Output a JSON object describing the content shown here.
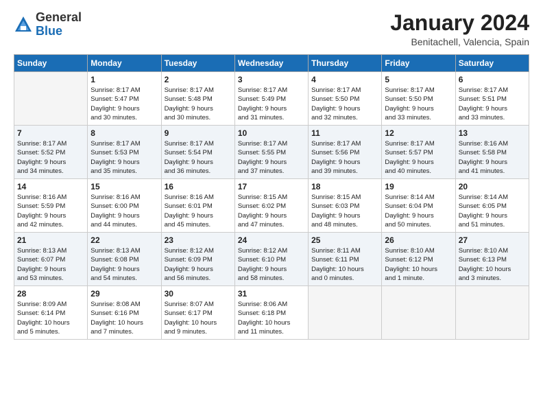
{
  "header": {
    "logo_general": "General",
    "logo_blue": "Blue",
    "month_title": "January 2024",
    "location": "Benitachell, Valencia, Spain"
  },
  "weekdays": [
    "Sunday",
    "Monday",
    "Tuesday",
    "Wednesday",
    "Thursday",
    "Friday",
    "Saturday"
  ],
  "weeks": [
    [
      {
        "day": "",
        "info": ""
      },
      {
        "day": "1",
        "info": "Sunrise: 8:17 AM\nSunset: 5:47 PM\nDaylight: 9 hours\nand 30 minutes."
      },
      {
        "day": "2",
        "info": "Sunrise: 8:17 AM\nSunset: 5:48 PM\nDaylight: 9 hours\nand 30 minutes."
      },
      {
        "day": "3",
        "info": "Sunrise: 8:17 AM\nSunset: 5:49 PM\nDaylight: 9 hours\nand 31 minutes."
      },
      {
        "day": "4",
        "info": "Sunrise: 8:17 AM\nSunset: 5:50 PM\nDaylight: 9 hours\nand 32 minutes."
      },
      {
        "day": "5",
        "info": "Sunrise: 8:17 AM\nSunset: 5:50 PM\nDaylight: 9 hours\nand 33 minutes."
      },
      {
        "day": "6",
        "info": "Sunrise: 8:17 AM\nSunset: 5:51 PM\nDaylight: 9 hours\nand 33 minutes."
      }
    ],
    [
      {
        "day": "7",
        "info": "Sunrise: 8:17 AM\nSunset: 5:52 PM\nDaylight: 9 hours\nand 34 minutes."
      },
      {
        "day": "8",
        "info": "Sunrise: 8:17 AM\nSunset: 5:53 PM\nDaylight: 9 hours\nand 35 minutes."
      },
      {
        "day": "9",
        "info": "Sunrise: 8:17 AM\nSunset: 5:54 PM\nDaylight: 9 hours\nand 36 minutes."
      },
      {
        "day": "10",
        "info": "Sunrise: 8:17 AM\nSunset: 5:55 PM\nDaylight: 9 hours\nand 37 minutes."
      },
      {
        "day": "11",
        "info": "Sunrise: 8:17 AM\nSunset: 5:56 PM\nDaylight: 9 hours\nand 39 minutes."
      },
      {
        "day": "12",
        "info": "Sunrise: 8:17 AM\nSunset: 5:57 PM\nDaylight: 9 hours\nand 40 minutes."
      },
      {
        "day": "13",
        "info": "Sunrise: 8:16 AM\nSunset: 5:58 PM\nDaylight: 9 hours\nand 41 minutes."
      }
    ],
    [
      {
        "day": "14",
        "info": "Sunrise: 8:16 AM\nSunset: 5:59 PM\nDaylight: 9 hours\nand 42 minutes."
      },
      {
        "day": "15",
        "info": "Sunrise: 8:16 AM\nSunset: 6:00 PM\nDaylight: 9 hours\nand 44 minutes."
      },
      {
        "day": "16",
        "info": "Sunrise: 8:16 AM\nSunset: 6:01 PM\nDaylight: 9 hours\nand 45 minutes."
      },
      {
        "day": "17",
        "info": "Sunrise: 8:15 AM\nSunset: 6:02 PM\nDaylight: 9 hours\nand 47 minutes."
      },
      {
        "day": "18",
        "info": "Sunrise: 8:15 AM\nSunset: 6:03 PM\nDaylight: 9 hours\nand 48 minutes."
      },
      {
        "day": "19",
        "info": "Sunrise: 8:14 AM\nSunset: 6:04 PM\nDaylight: 9 hours\nand 50 minutes."
      },
      {
        "day": "20",
        "info": "Sunrise: 8:14 AM\nSunset: 6:05 PM\nDaylight: 9 hours\nand 51 minutes."
      }
    ],
    [
      {
        "day": "21",
        "info": "Sunrise: 8:13 AM\nSunset: 6:07 PM\nDaylight: 9 hours\nand 53 minutes."
      },
      {
        "day": "22",
        "info": "Sunrise: 8:13 AM\nSunset: 6:08 PM\nDaylight: 9 hours\nand 54 minutes."
      },
      {
        "day": "23",
        "info": "Sunrise: 8:12 AM\nSunset: 6:09 PM\nDaylight: 9 hours\nand 56 minutes."
      },
      {
        "day": "24",
        "info": "Sunrise: 8:12 AM\nSunset: 6:10 PM\nDaylight: 9 hours\nand 58 minutes."
      },
      {
        "day": "25",
        "info": "Sunrise: 8:11 AM\nSunset: 6:11 PM\nDaylight: 10 hours\nand 0 minutes."
      },
      {
        "day": "26",
        "info": "Sunrise: 8:10 AM\nSunset: 6:12 PM\nDaylight: 10 hours\nand 1 minute."
      },
      {
        "day": "27",
        "info": "Sunrise: 8:10 AM\nSunset: 6:13 PM\nDaylight: 10 hours\nand 3 minutes."
      }
    ],
    [
      {
        "day": "28",
        "info": "Sunrise: 8:09 AM\nSunset: 6:14 PM\nDaylight: 10 hours\nand 5 minutes."
      },
      {
        "day": "29",
        "info": "Sunrise: 8:08 AM\nSunset: 6:16 PM\nDaylight: 10 hours\nand 7 minutes."
      },
      {
        "day": "30",
        "info": "Sunrise: 8:07 AM\nSunset: 6:17 PM\nDaylight: 10 hours\nand 9 minutes."
      },
      {
        "day": "31",
        "info": "Sunrise: 8:06 AM\nSunset: 6:18 PM\nDaylight: 10 hours\nand 11 minutes."
      },
      {
        "day": "",
        "info": ""
      },
      {
        "day": "",
        "info": ""
      },
      {
        "day": "",
        "info": ""
      }
    ]
  ]
}
